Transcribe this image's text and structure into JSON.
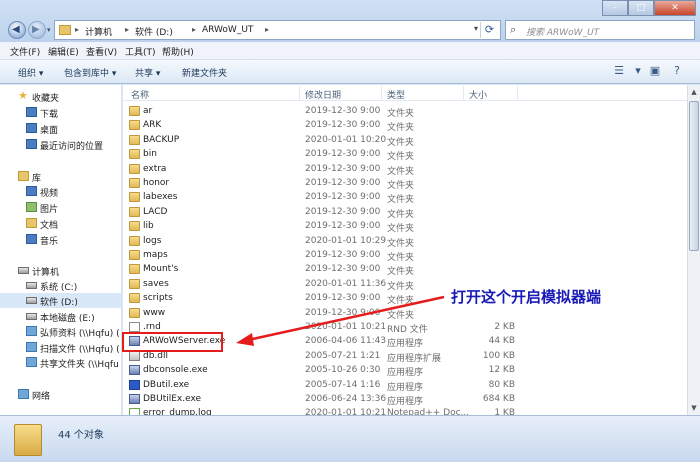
{
  "window": {
    "address": {
      "crumbs": [
        "计算机",
        "软件 (D:)",
        "ARWoW_UT"
      ],
      "separator": "▸"
    },
    "search_placeholder": "搜索 ARWoW_UT"
  },
  "menubar": {
    "items": [
      "文件(F)",
      "编辑(E)",
      "查看(V)",
      "工具(T)",
      "帮助(H)"
    ]
  },
  "toolbar": {
    "organize": "组织 ▾",
    "include_in_library": "包含到库中 ▾",
    "share": "共享 ▾",
    "new_folder": "新建文件夹"
  },
  "navpane": {
    "favorites": "收藏夹",
    "favorites_items": [
      "下载",
      "桌面",
      "最近访问的位置"
    ],
    "libraries": "库",
    "library_items": [
      "视频",
      "图片",
      "文档",
      "音乐"
    ],
    "computer": "计算机",
    "computer_items": [
      "系统 (C:)",
      "软件 (D:)",
      "本地磁盘 (E:)",
      "弘师资料 (\\\\Hqfu) (",
      "扫描文件 (\\\\Hqfu) (",
      "共享文件夹 (\\\\Hqfu"
    ],
    "network": "网络"
  },
  "columns": {
    "name": "名称",
    "date": "修改日期",
    "type": "类型",
    "size": "大小"
  },
  "files": [
    {
      "name": "ar",
      "date": "2019-12-30 9:00",
      "type": "文件夹",
      "size": "",
      "icon": "folder"
    },
    {
      "name": "ARK",
      "date": "2019-12-30 9:00",
      "type": "文件夹",
      "size": "",
      "icon": "folder"
    },
    {
      "name": "BACKUP",
      "date": "2020-01-01 10:20",
      "type": "文件夹",
      "size": "",
      "icon": "folder"
    },
    {
      "name": "bin",
      "date": "2019-12-30 9:00",
      "type": "文件夹",
      "size": "",
      "icon": "folder"
    },
    {
      "name": "extra",
      "date": "2019-12-30 9:00",
      "type": "文件夹",
      "size": "",
      "icon": "folder"
    },
    {
      "name": "honor",
      "date": "2019-12-30 9:00",
      "type": "文件夹",
      "size": "",
      "icon": "folder"
    },
    {
      "name": "labexes",
      "date": "2019-12-30 9:00",
      "type": "文件夹",
      "size": "",
      "icon": "folder"
    },
    {
      "name": "LACD",
      "date": "2019-12-30 9:00",
      "type": "文件夹",
      "size": "",
      "icon": "folder"
    },
    {
      "name": "lib",
      "date": "2019-12-30 9:00",
      "type": "文件夹",
      "size": "",
      "icon": "folder"
    },
    {
      "name": "logs",
      "date": "2020-01-01 10:29",
      "type": "文件夹",
      "size": "",
      "icon": "folder"
    },
    {
      "name": "maps",
      "date": "2019-12-30 9:00",
      "type": "文件夹",
      "size": "",
      "icon": "folder"
    },
    {
      "name": "Mount's",
      "date": "2019-12-30 9:00",
      "type": "文件夹",
      "size": "",
      "icon": "folder"
    },
    {
      "name": "saves",
      "date": "2020-01-01 11:36",
      "type": "文件夹",
      "size": "",
      "icon": "folder"
    },
    {
      "name": "scripts",
      "date": "2019-12-30 9:00",
      "type": "文件夹",
      "size": "",
      "icon": "folder"
    },
    {
      "name": "www",
      "date": "2019-12-30 9:00",
      "type": "文件夹",
      "size": "",
      "icon": "folder"
    },
    {
      "name": ".rnd",
      "date": "2020-01-01 10:21",
      "type": "RND 文件",
      "size": "2 KB",
      "icon": "file"
    },
    {
      "name": "ARWoWServer.exe",
      "date": "2006-04-06 11:43",
      "type": "应用程序",
      "size": "44 KB",
      "icon": "exe"
    },
    {
      "name": "db.dll",
      "date": "2005-07-21 1:21",
      "type": "应用程序扩展",
      "size": "100 KB",
      "icon": "dll"
    },
    {
      "name": "dbconsole.exe",
      "date": "2005-10-26 0:30",
      "type": "应用程序",
      "size": "12 KB",
      "icon": "exe"
    },
    {
      "name": "DButil.exe",
      "date": "2005-07-14 1:16",
      "type": "应用程序",
      "size": "80 KB",
      "icon": "blue"
    },
    {
      "name": "DBUtilEx.exe",
      "date": "2006-06-24 13:36",
      "type": "应用程序",
      "size": "684 KB",
      "icon": "exe"
    },
    {
      "name": "error_dump.log",
      "date": "2020-01-01 10:21",
      "type": "Notepad++ Doc...",
      "size": "1 KB",
      "icon": "np"
    }
  ],
  "status": {
    "count": "44 个对象"
  },
  "annotation": {
    "text": "打开这个开启模拟器端",
    "color": "#1a1ab6",
    "highlight_color": "#e51c1c"
  }
}
